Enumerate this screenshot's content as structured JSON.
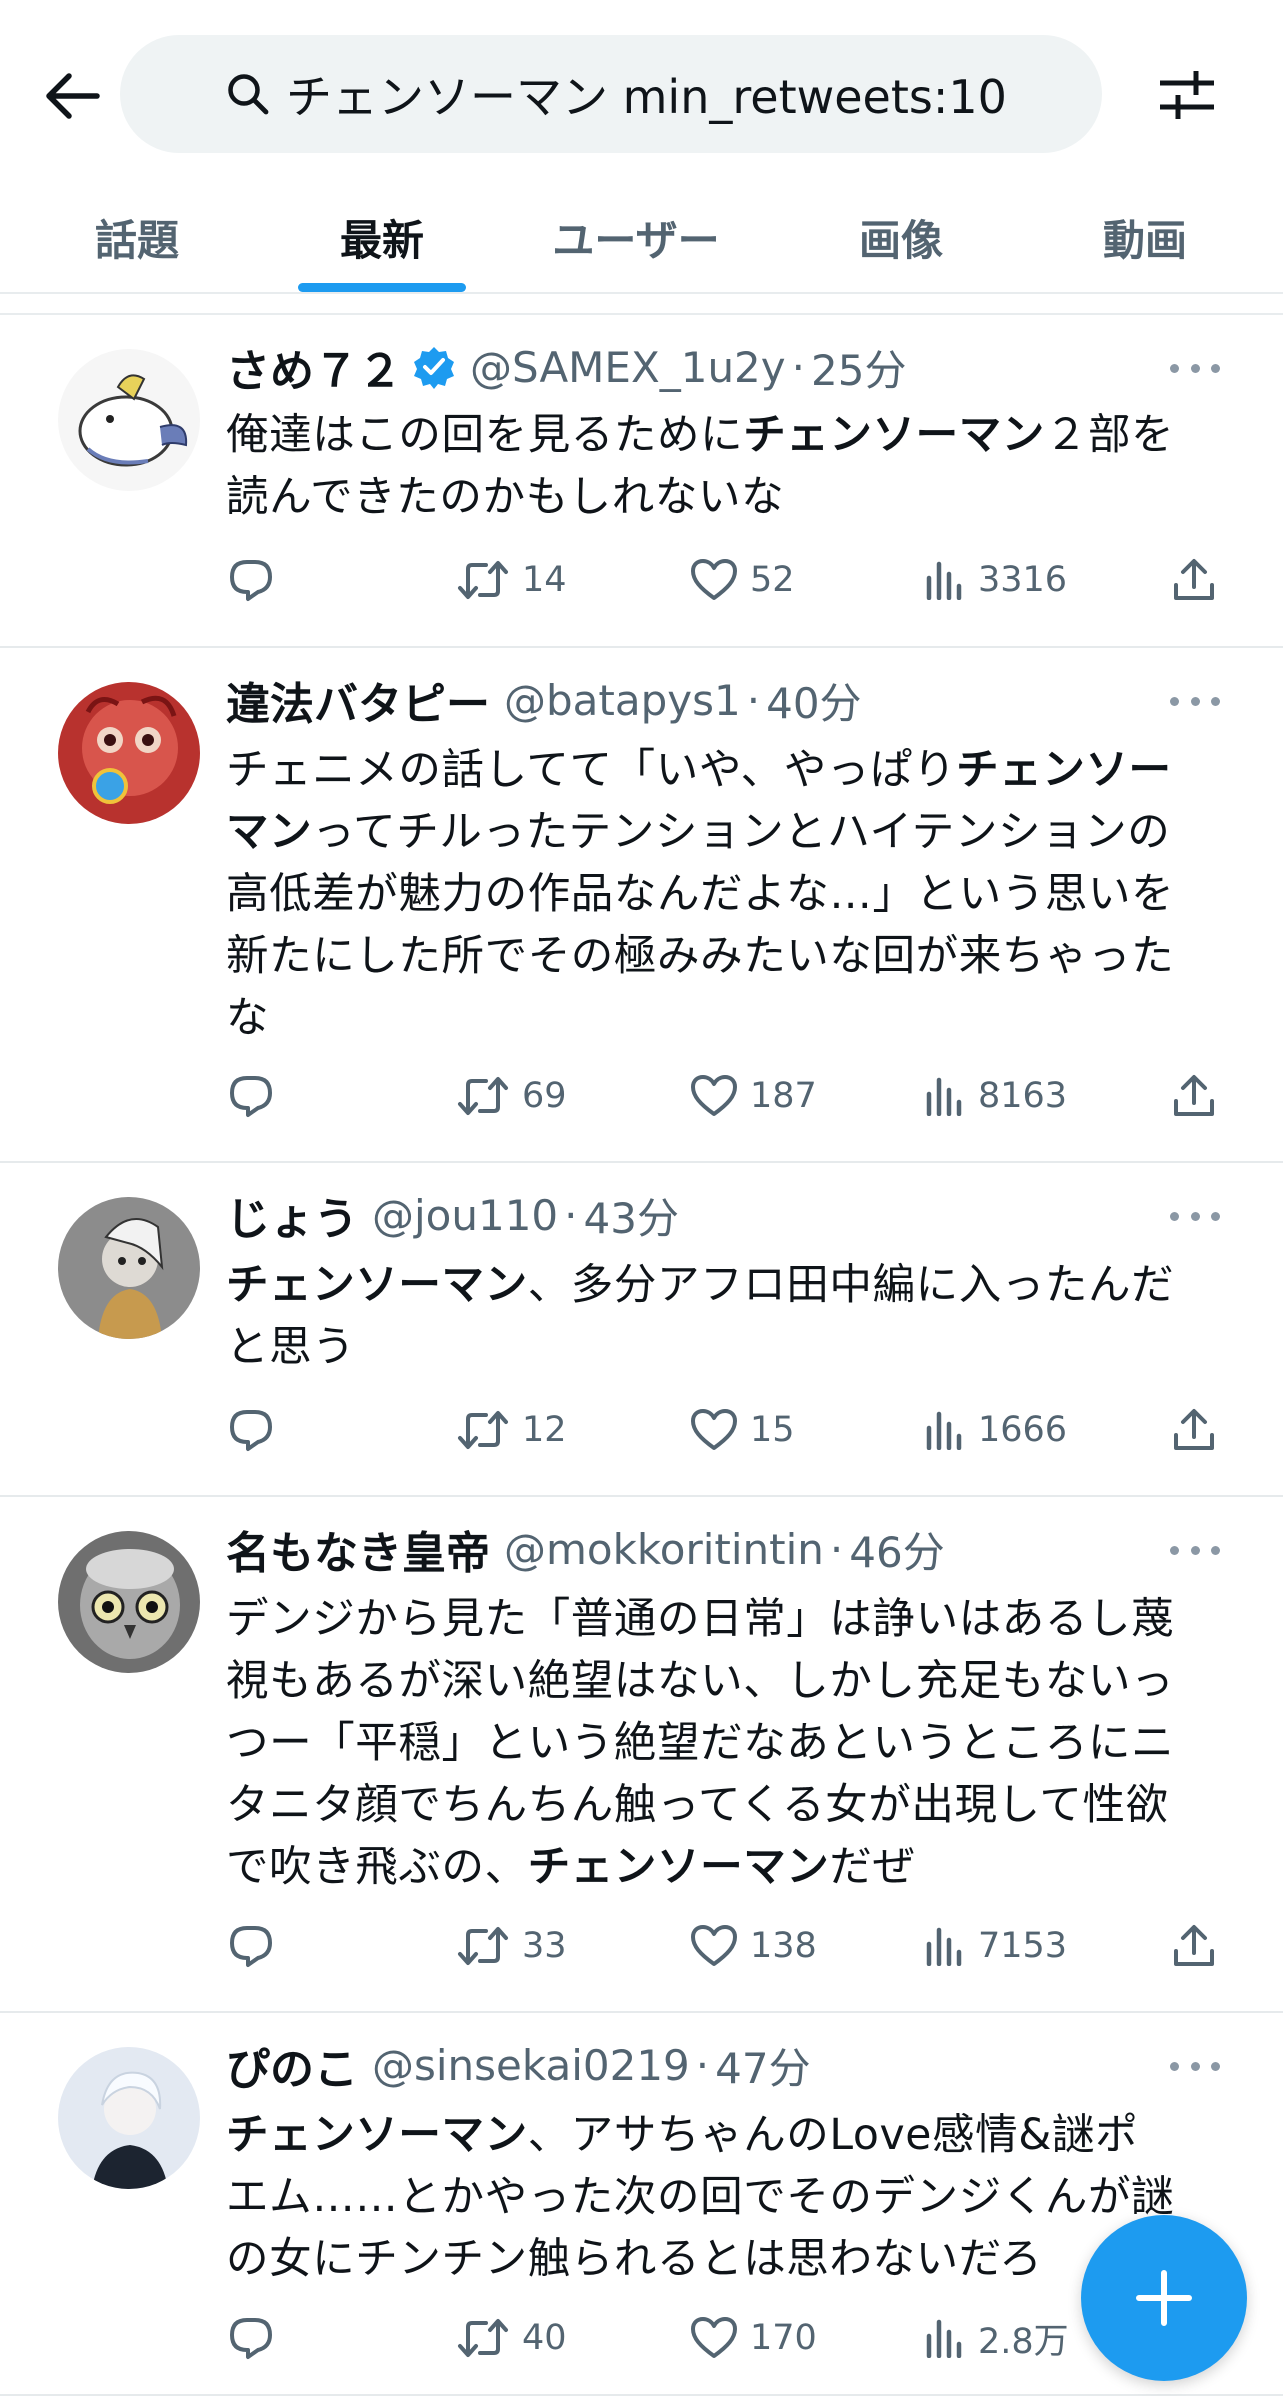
{
  "search": {
    "query": "チェンソーマン min_retweets:10"
  },
  "tabs": [
    {
      "label": "話題"
    },
    {
      "label": "最新"
    },
    {
      "label": "ユーザー"
    },
    {
      "label": "画像"
    },
    {
      "label": "動画"
    }
  ],
  "colors": {
    "accent": "#1d9bf0",
    "text": "#0f1419",
    "secondary": "#536471"
  },
  "icons": {
    "back": "arrow-left-icon",
    "search": "search-icon",
    "filter": "sliders-icon",
    "reply": "reply-icon",
    "retweet": "retweet-icon",
    "like": "heart-icon",
    "views": "views-bar-icon",
    "share": "share-icon",
    "verified": "verified-badge-icon",
    "fab": "plus-icon"
  },
  "tweets": [
    {
      "name": "さめ７２",
      "verified": true,
      "handle": "@SAMEX_1u2y",
      "dot": "·",
      "time": "25分",
      "lines": [
        [
          {
            "t": "俺達はこの回を見るために"
          },
          {
            "t": "チェンソーマン",
            "b": true
          },
          {
            "t": "２部を"
          }
        ],
        [
          {
            "t": "読んできたのかもしれないな"
          }
        ]
      ],
      "retweets": "14",
      "likes": "52",
      "views": "3316"
    },
    {
      "name": "違法バタピー",
      "verified": false,
      "handle": "@batapys1",
      "dot": "·",
      "time": "40分",
      "lines": [
        [
          {
            "t": "チェニメの話してて「いや、やっぱり"
          },
          {
            "t": "チェンソー",
            "b": true
          }
        ],
        [
          {
            "t": "マン",
            "b": true
          },
          {
            "t": "ってチルったテンションとハイテンションの"
          }
        ],
        [
          {
            "t": "高低差が魅力の作品なんだよな…」という思いを"
          }
        ],
        [
          {
            "t": "新たにした所でその極みみたいな回が来ちゃった"
          }
        ],
        [
          {
            "t": "な"
          }
        ]
      ],
      "retweets": "69",
      "likes": "187",
      "views": "8163"
    },
    {
      "name": "じょう",
      "verified": false,
      "handle": "@jou110",
      "dot": "·",
      "time": "43分",
      "lines": [
        [
          {
            "t": "チェンソーマン",
            "b": true
          },
          {
            "t": "、多分アフロ田中編に入ったんだ"
          }
        ],
        [
          {
            "t": "と思う"
          }
        ]
      ],
      "retweets": "12",
      "likes": "15",
      "views": "1666"
    },
    {
      "name": "名もなき皇帝",
      "verified": false,
      "handle": "@mokkoritintin",
      "dot": "·",
      "time": "46分",
      "lines": [
        [
          {
            "t": "デンジから見た「普通の日常」は諍いはあるし蔑"
          }
        ],
        [
          {
            "t": "視もあるが深い絶望はない、しかし充足もないっ"
          }
        ],
        [
          {
            "t": "つー「平穏」という絶望だなあというところにニ"
          }
        ],
        [
          {
            "t": "タニタ顔でちんちん触ってくる女が出現して性欲"
          }
        ],
        [
          {
            "t": "で吹き飛ぶの、"
          },
          {
            "t": "チェンソーマン",
            "b": true
          },
          {
            "t": "だぜ"
          }
        ]
      ],
      "retweets": "33",
      "likes": "138",
      "views": "7153"
    },
    {
      "name": "ぴのこ",
      "verified": false,
      "handle": "@sinsekai0219",
      "dot": "·",
      "time": "47分",
      "lines": [
        [
          {
            "t": "チェンソーマン",
            "b": true
          },
          {
            "t": "、アサちゃんのLove感情&謎ポ"
          }
        ],
        [
          {
            "t": "エム……とかやった次の回でそのデンジくんが謎"
          }
        ],
        [
          {
            "t": "の女にチンチン触られるとは思わないだろ"
          }
        ]
      ],
      "retweets": "40",
      "likes": "170",
      "views": "2.8万"
    }
  ]
}
